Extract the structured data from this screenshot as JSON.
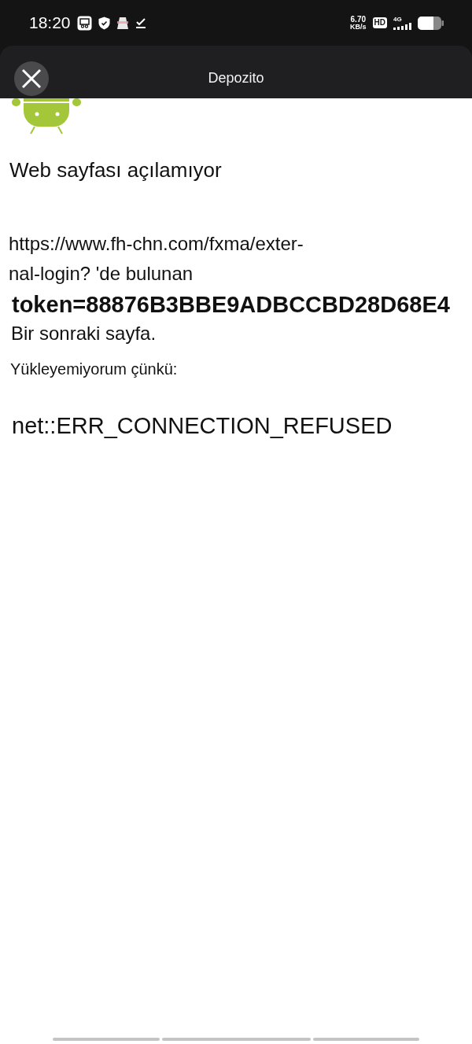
{
  "status_bar": {
    "time": "18:20",
    "speed_value": "6.70",
    "speed_unit": "KB/s",
    "hd_badge": "HD",
    "network_type": "4G"
  },
  "header": {
    "title": "Depozito"
  },
  "page": {
    "heading": "Web sayfası açılamıyor",
    "url_lines": [
      "https://www.fh-chn.com/fxma/exter-",
      "nal-login? 'de bulunan"
    ],
    "token": "token=88876B3BBE9ADBCCBD28D68E4",
    "next_text": "Bir sonraki sayfa.",
    "reason_label": "Yükleyemiyorum çünkü:",
    "error_code": "net::ERR_CONNECTION_REFUSED"
  }
}
